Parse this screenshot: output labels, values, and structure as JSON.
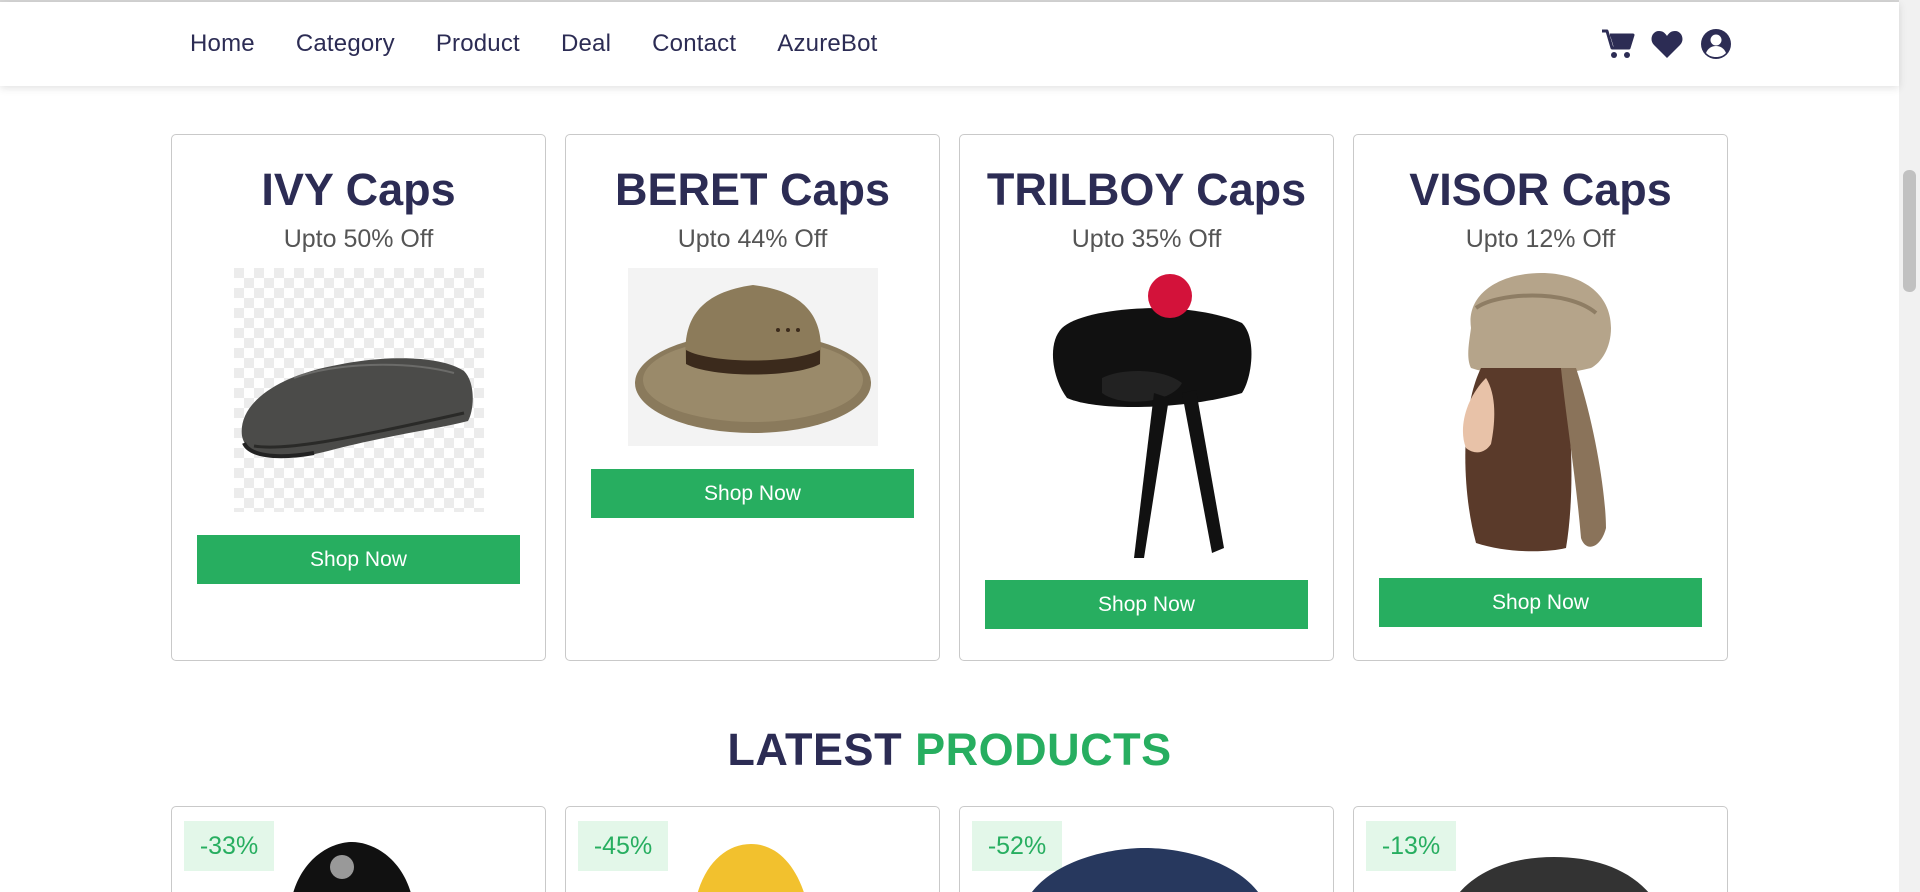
{
  "nav": {
    "links": [
      "Home",
      "Category",
      "Product",
      "Deal",
      "Contact",
      "AzureBot"
    ],
    "icons": [
      "cart-icon",
      "heart-icon",
      "user-icon"
    ]
  },
  "deals": [
    {
      "title": "IVY Caps",
      "offer": "Upto 50% Off",
      "button": "Shop Now",
      "image": "ivy-cap"
    },
    {
      "title": "BERET Caps",
      "offer": "Upto 44% Off",
      "button": "Shop Now",
      "image": "felt-hat"
    },
    {
      "title": "TRILBOY Caps",
      "offer": "Upto 35% Off",
      "button": "Shop Now",
      "image": "glengarry-cap"
    },
    {
      "title": "VISOR Caps",
      "offer": "Upto 12% Off",
      "button": "Shop Now",
      "image": "fur-hat"
    }
  ],
  "latest": {
    "title_part1": "LATEST",
    "title_part2": "PRODUCTS",
    "badges": [
      "-33%",
      "-45%",
      "-52%",
      "-13%"
    ]
  },
  "colors": {
    "primary": "#2c2c54",
    "accent": "#27ae60",
    "badge_bg": "#e3f7e9"
  }
}
